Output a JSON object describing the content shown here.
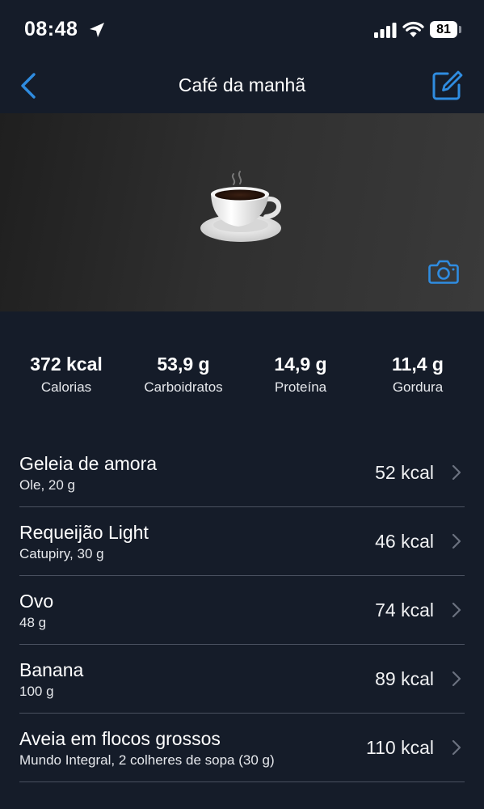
{
  "status_bar": {
    "time": "08:48",
    "battery": "81"
  },
  "nav": {
    "title": "Café da manhã",
    "icons": {
      "back": "chevron-left-icon",
      "edit": "edit-icon"
    }
  },
  "hero": {
    "image": "hot-beverage-emoji",
    "camera_icon": "camera-icon"
  },
  "summary": [
    {
      "value": "372 kcal",
      "label": "Calorias"
    },
    {
      "value": "53,9 g",
      "label": "Carboidratos"
    },
    {
      "value": "14,9 g",
      "label": "Proteína"
    },
    {
      "value": "11,4 g",
      "label": "Gordura"
    }
  ],
  "foods": [
    {
      "name": "Geleia de amora",
      "detail": "Ole, 20 g",
      "kcal": "52 kcal"
    },
    {
      "name": "Requeijão Light",
      "detail": "Catupiry, 30 g",
      "kcal": "46 kcal"
    },
    {
      "name": "Ovo",
      "detail": "48 g",
      "kcal": "74 kcal"
    },
    {
      "name": "Banana",
      "detail": "100 g",
      "kcal": "89 kcal"
    },
    {
      "name": "Aveia em flocos grossos",
      "detail": "Mundo Integral, 2 colheres de sopa (30 g)",
      "kcal": "110 kcal"
    }
  ],
  "colors": {
    "background": "#151c29",
    "accent": "#2f8ce0",
    "divider": "#4a5160"
  }
}
